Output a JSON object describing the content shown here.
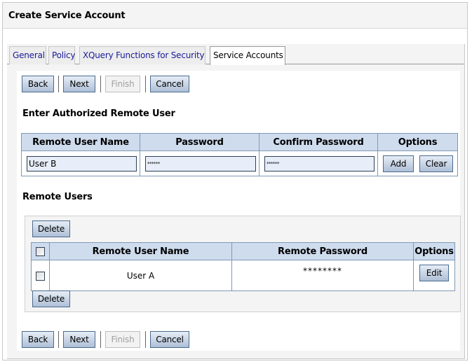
{
  "page": {
    "title": "Create Service Account"
  },
  "tabs": [
    {
      "label": "General",
      "active": false
    },
    {
      "label": "Policy",
      "active": false
    },
    {
      "label": "XQuery Functions for Security",
      "active": false
    },
    {
      "label": "Service Accounts",
      "active": true
    }
  ],
  "wizard": {
    "back_label": "Back",
    "next_label": "Next",
    "finish_label": "Finish",
    "finish_enabled": false,
    "cancel_label": "Cancel"
  },
  "enter_user": {
    "title": "Enter Authorized Remote User",
    "columns": [
      "Remote User Name",
      "Password",
      "Confirm Password",
      "Options"
    ],
    "user_name_value": "User B",
    "password_value": "******",
    "confirm_password_value": "******",
    "add_label": "Add",
    "clear_label": "Clear"
  },
  "remote_users": {
    "title": "Remote Users",
    "delete_label": "Delete",
    "columns": [
      "",
      "Remote User Name",
      "Remote Password",
      "Options"
    ],
    "rows": [
      {
        "checked": false,
        "name": "User A",
        "password": "********",
        "edit_label": "Edit"
      }
    ]
  }
}
